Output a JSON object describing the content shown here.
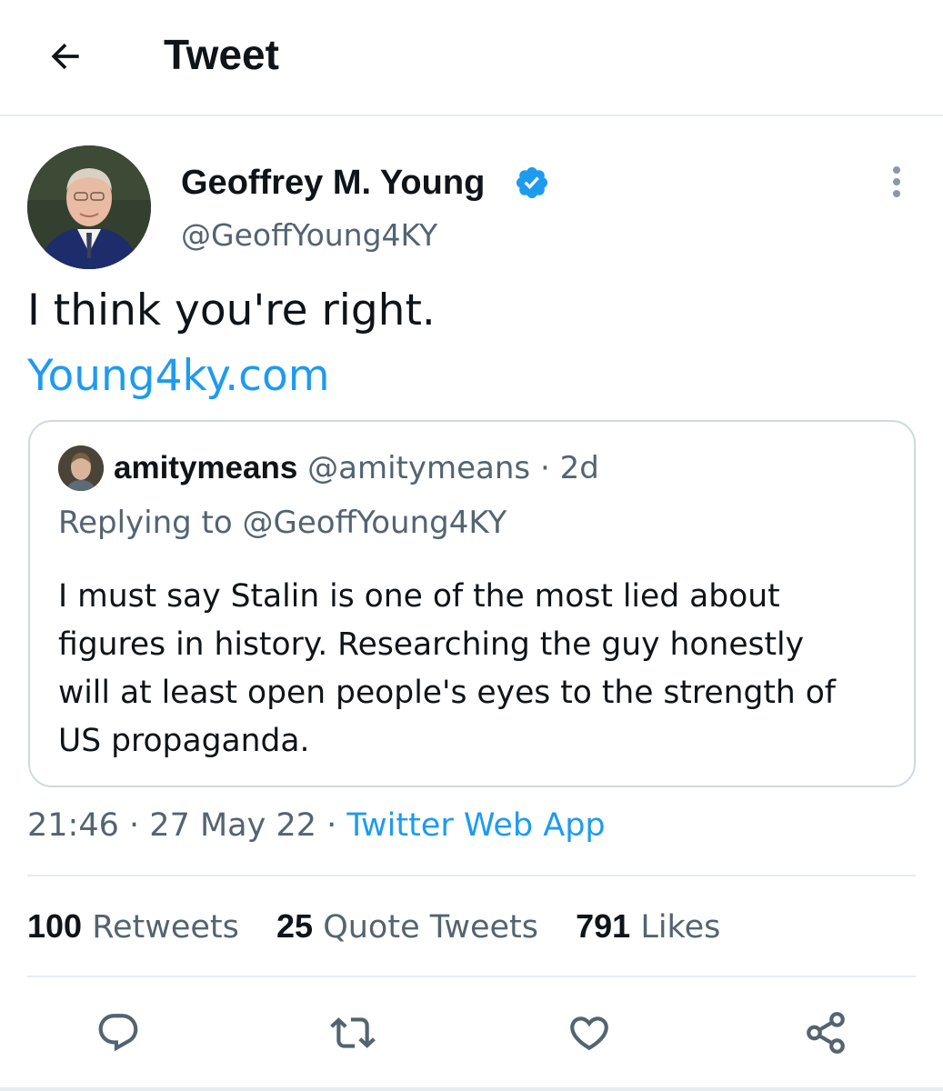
{
  "header": {
    "title": "Tweet",
    "back_icon": "arrow-left-icon"
  },
  "tweet": {
    "author": {
      "display_name": "Geoffrey M. Young",
      "handle": "@GeoffYoung4KY",
      "verified_icon": "verified-badge-icon"
    },
    "text": "I think you're right.",
    "link": "Young4ky.com",
    "quoted": {
      "display_name": "amitymeans",
      "handle": "@amitymeans",
      "separator": "·",
      "age": "2d",
      "replying_prefix": "Replying to",
      "replying_handle": "@GeoffYoung4KY",
      "text_lines": [
        "I must say Stalin is one of the most lied about",
        "figures in history. Researching the guy honestly",
        "will at least open people's eyes to the strength of",
        "US propaganda."
      ]
    },
    "meta": {
      "time": "21:46",
      "separator": "·",
      "date": "27 May 22",
      "source": "Twitter Web App"
    },
    "stats": [
      {
        "count": "100",
        "label": "Retweets"
      },
      {
        "count": "25",
        "label": "Quote Tweets"
      },
      {
        "count": "791",
        "label": "Likes"
      }
    ],
    "actions": [
      "reply-icon",
      "retweet-icon",
      "like-icon",
      "share-icon"
    ]
  },
  "colors": {
    "accent": "#1d9bf0",
    "text_primary": "#0f1419",
    "text_secondary": "#536471",
    "border": "#cfd9de",
    "divider": "#e6ecf0"
  }
}
